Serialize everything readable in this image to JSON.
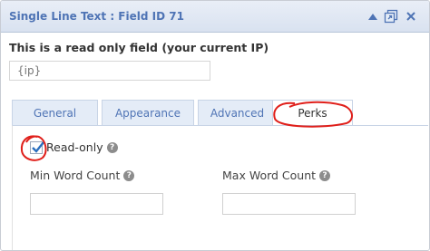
{
  "window": {
    "title": "Single Line Text : Field ID 71",
    "icons": [
      "collapse-icon",
      "duplicate-icon",
      "delete-icon"
    ],
    "accent_color": "#4f74b5",
    "annotation_color": "#e0201b"
  },
  "field": {
    "label": "This is a read only field (your current IP)",
    "placeholder": "{ip}"
  },
  "tabs": [
    {
      "label": "General"
    },
    {
      "label": "Appearance"
    },
    {
      "label": "Advanced"
    },
    {
      "label": "Perks",
      "active": true
    }
  ],
  "perks": {
    "readonly_label": "Read-only",
    "readonly_checked": true,
    "min_word_count_label": "Min Word Count",
    "max_word_count_label": "Max Word Count",
    "min_word_count_value": "",
    "max_word_count_value": ""
  }
}
